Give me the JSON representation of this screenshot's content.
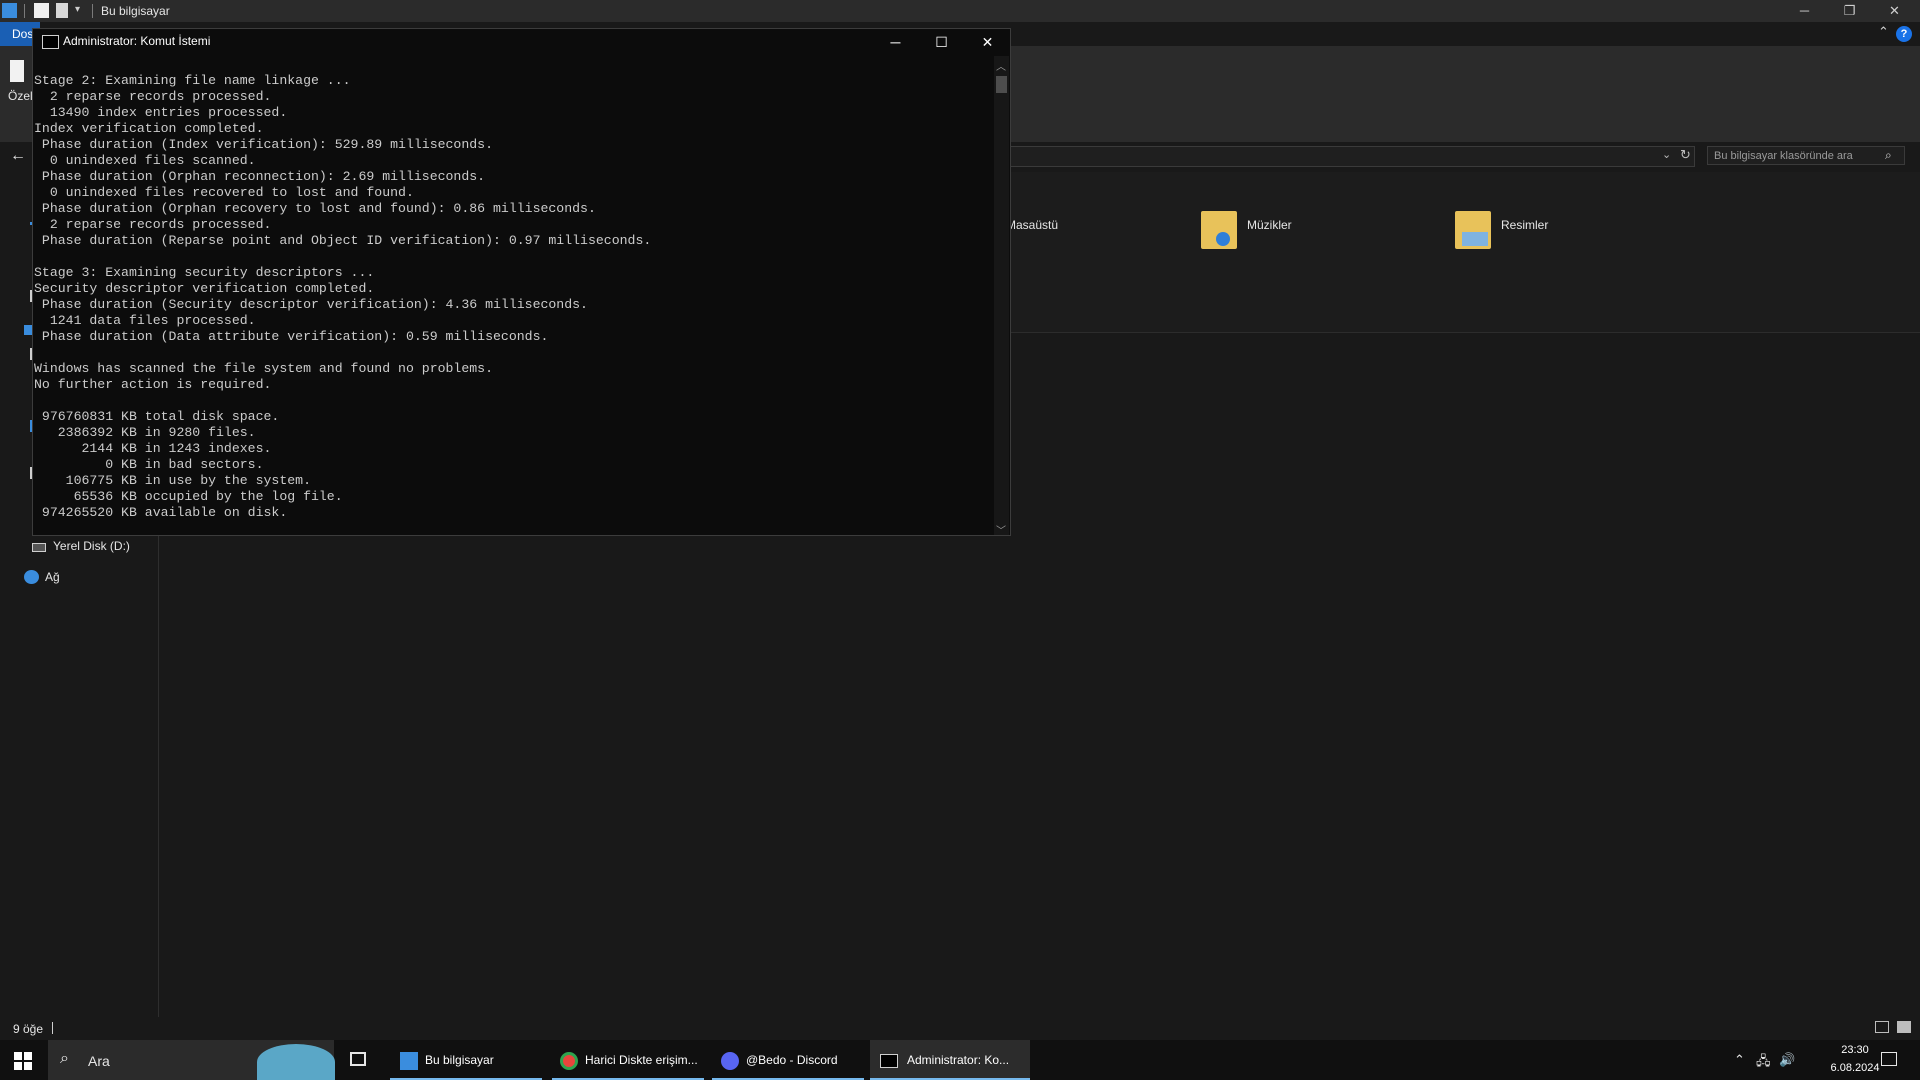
{
  "explorer": {
    "title": "Bu bilgisayar",
    "ribbon": {
      "file_tab": "Dosya",
      "pin_label": "Özelleştir"
    },
    "search_placeholder": "Bu bilgisayar klasöründe ara",
    "folders": [
      {
        "name": "Masaüstü",
        "icon": "desktop-folder-icon"
      },
      {
        "name": "Müzikler",
        "icon": "music-folder-icon"
      },
      {
        "name": "Resimler",
        "icon": "pictures-folder-icon"
      }
    ],
    "nav": [
      {
        "label": "Yerel Disk (D:)",
        "icon": "drive-icon"
      },
      {
        "label": "Ağ",
        "icon": "network-icon"
      }
    ],
    "status": {
      "item_count": "9 öğe"
    }
  },
  "cmd": {
    "title": "Administrator: Komut İstemi",
    "output": "Stage 2: Examining file name linkage ...\n  2 reparse records processed.\n  13490 index entries processed.\nIndex verification completed.\n Phase duration (Index verification): 529.89 milliseconds.\n  0 unindexed files scanned.\n Phase duration (Orphan reconnection): 2.69 milliseconds.\n  0 unindexed files recovered to lost and found.\n Phase duration (Orphan recovery to lost and found): 0.86 milliseconds.\n  2 reparse records processed.\n Phase duration (Reparse point and Object ID verification): 0.97 milliseconds.\n\nStage 3: Examining security descriptors ...\nSecurity descriptor verification completed.\n Phase duration (Security descriptor verification): 4.36 milliseconds.\n  1241 data files processed.\n Phase duration (Data attribute verification): 0.59 milliseconds.\n\nWindows has scanned the file system and found no problems.\nNo further action is required.\n\n 976760831 KB total disk space.\n   2386392 KB in 9280 files.\n      2144 KB in 1243 indexes.\n         0 KB in bad sectors.\n    106775 KB in use by the system.\n     65536 KB occupied by the log file.\n 974265520 KB available on disk."
  },
  "taskbar": {
    "search_placeholder": "Ara",
    "apps": [
      {
        "label": "Bu bilgisayar",
        "icon": "explorer-icon"
      },
      {
        "label": "Harici Diskte erişim...",
        "icon": "chrome-icon"
      },
      {
        "label": "@Bedo - Discord",
        "icon": "discord-icon"
      },
      {
        "label": "Administrator: Ko...",
        "icon": "cmd-icon"
      }
    ],
    "clock": {
      "time": "23:30",
      "date": "6.08.2024"
    }
  }
}
